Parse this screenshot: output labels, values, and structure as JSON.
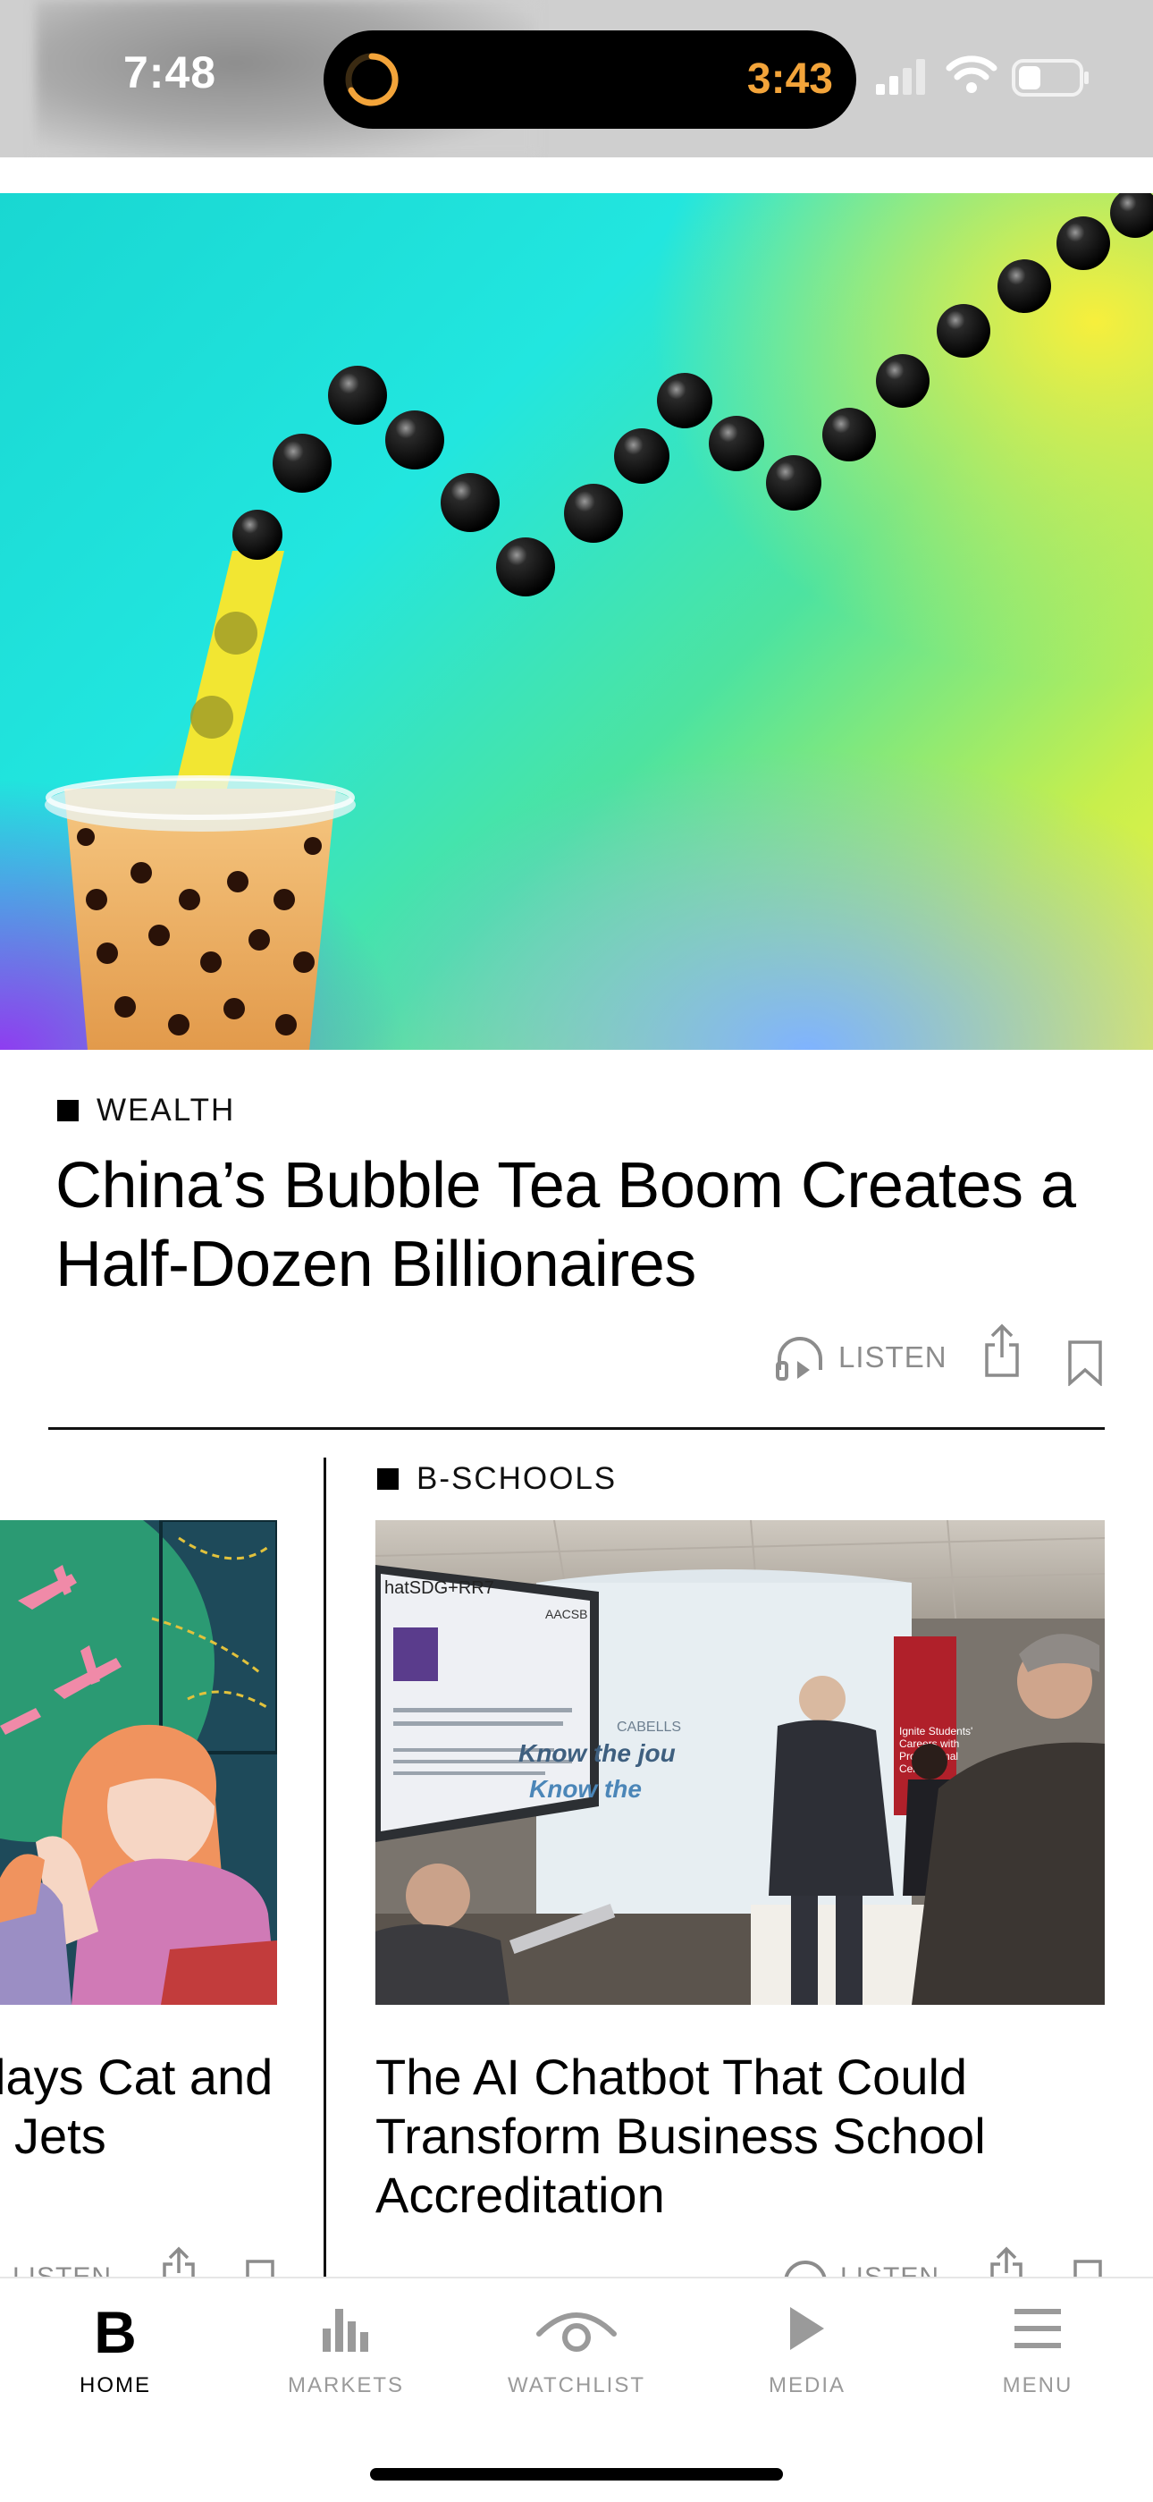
{
  "status_bar": {
    "time": "7:48",
    "timer_time": "3:43",
    "icons": [
      "timer-ring-icon",
      "cellular-signal-icon",
      "wifi-icon",
      "battery-icon"
    ]
  },
  "lead_story": {
    "kicker": "WEALTH",
    "headline": "China’s Bubble Tea Boom Creates a Half-Dozen Billionaires",
    "listen_label": "LISTEN",
    "image": "bubble-tea-chart-illustration"
  },
  "cards": [
    {
      "headline": "…lays Cat and … Jets",
      "headline_line1": "lays Cat and",
      "headline_line2": "Jets",
      "listen_label": "LISTEN",
      "image": "illustration-planes-people"
    },
    {
      "kicker": "B-SCHOOLS",
      "headline": "The AI Chatbot That Could Transform Business School Accreditation",
      "listen_label": "LISTEN",
      "image": "conference-booth-photo",
      "photo_texts": {
        "screen_header": "hatSDG+RR7",
        "screen_badge": "AACSB",
        "screen_title": "Differences in the Perceived Influence of Natural Disasters and Travel Risk on International Travel",
        "booth_brand": "CABELLS",
        "booth_line1": "Know the jou",
        "booth_line2": "Know the",
        "poster_line1": "Ignite Students'",
        "poster_line2": "Careers with",
        "poster_line3": "Professional",
        "poster_line4": "Certificat"
      }
    }
  ],
  "tab_bar": {
    "tabs": [
      {
        "label": "HOME",
        "icon": "bloomberg-b-icon",
        "active": true
      },
      {
        "label": "MARKETS",
        "icon": "bar-chart-icon",
        "active": false
      },
      {
        "label": "WATCHLIST",
        "icon": "eye-icon",
        "active": false
      },
      {
        "label": "MEDIA",
        "icon": "play-icon",
        "active": false
      },
      {
        "label": "MENU",
        "icon": "hamburger-menu-icon",
        "active": false
      }
    ]
  },
  "colors": {
    "timer_accent": "#f3a43a",
    "muted_text": "#8c8c8c",
    "divider": "#111111"
  }
}
